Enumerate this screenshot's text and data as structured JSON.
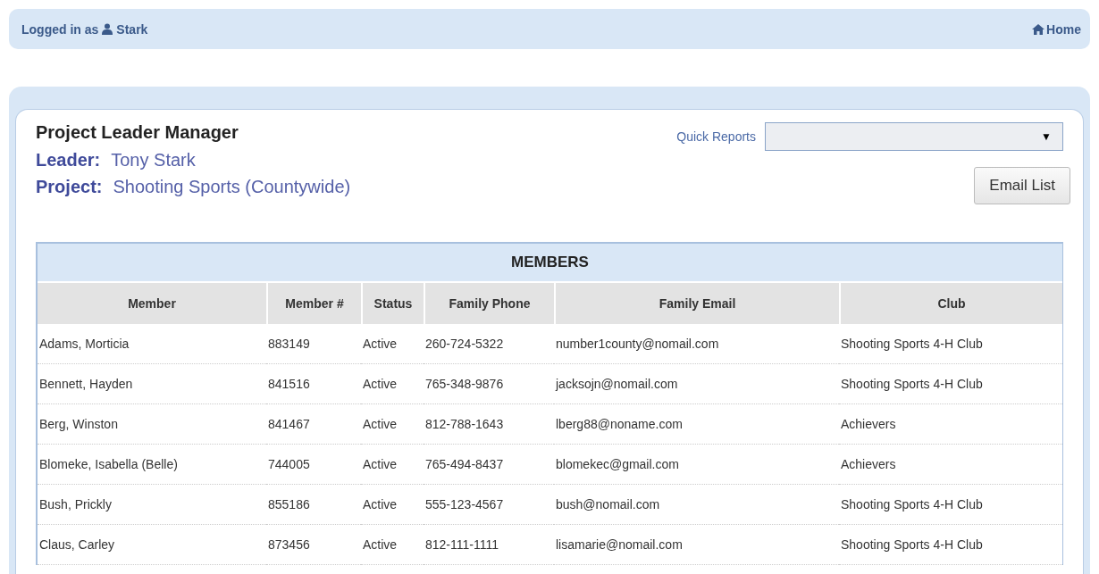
{
  "top_bar": {
    "logged_in_label": "Logged in as",
    "user": "Stark",
    "home_link": "Home"
  },
  "page": {
    "title": "Project Leader Manager",
    "leader_label": "Leader:",
    "leader": "Tony Stark",
    "project_label": "Project:",
    "project": "Shooting Sports (Countywide)",
    "quick_reports_label": "Quick Reports",
    "quick_reports_arrow": "▼",
    "email_button": "Email List"
  },
  "table": {
    "title": "MEMBERS",
    "columns": [
      "Member",
      "Member #",
      "Status",
      "Family Phone",
      "Family Email",
      "Club"
    ],
    "rows": [
      [
        "Adams, Morticia",
        "883149",
        "Active",
        "260-724-5322",
        "number1county@nomail.com",
        "Shooting Sports 4-H Club"
      ],
      [
        "Bennett, Hayden",
        "841516",
        "Active",
        "765-348-9876",
        "jacksojn@nomail.com",
        "Shooting Sports 4-H Club"
      ],
      [
        "Berg, Winston",
        "841467",
        "Active",
        "812-788-1643",
        "lberg88@noname.com",
        "Achievers"
      ],
      [
        "Blomeke, Isabella (Belle)",
        "744005",
        "Active",
        "765-494-8437",
        "blomekec@gmail.com",
        "Achievers"
      ],
      [
        "Bush, Prickly",
        "855186",
        "Active",
        "555-123-4567",
        "bush@nomail.com",
        "Shooting Sports 4-H Club"
      ],
      [
        "Claus, Carley",
        "873456",
        "Active",
        "812-111-1111",
        "lisamarie@nomail.com",
        "Shooting Sports 4-H Club"
      ]
    ]
  }
}
